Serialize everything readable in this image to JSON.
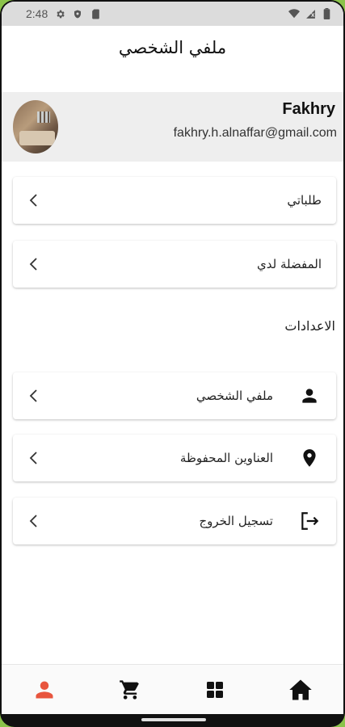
{
  "status_bar": {
    "time": "2:48",
    "icons_left": [
      "settings-icon",
      "shield-icon",
      "sim-icon"
    ],
    "icons_right": [
      "wifi-icon",
      "signal-icon",
      "battery-icon"
    ]
  },
  "header": {
    "title": "ملفي الشخصي"
  },
  "profile": {
    "name": "Fakhry",
    "email": "fakhry.h.alnaffar@gmail.com",
    "avatar": "profile-photo"
  },
  "menu": {
    "orders_label": "طلباتي",
    "favorites_label": "المفضلة لدي"
  },
  "settings": {
    "title": "الاعدادات",
    "items": [
      {
        "label": "ملفي الشخصي",
        "icon": "person-icon"
      },
      {
        "label": "العناوين المحفوظة",
        "icon": "location-pin-icon"
      },
      {
        "label": "تسجيل الخروج",
        "icon": "logout-icon"
      }
    ]
  },
  "bottom_nav": {
    "items": [
      {
        "icon": "profile-icon",
        "active": true
      },
      {
        "icon": "cart-icon",
        "active": false
      },
      {
        "icon": "categories-icon",
        "active": false
      },
      {
        "icon": "home-icon",
        "active": false
      }
    ]
  },
  "colors": {
    "accent": "#e8553e",
    "icon": "#111111",
    "band": "#eeeeee",
    "device_edge": "#8bc34a"
  }
}
